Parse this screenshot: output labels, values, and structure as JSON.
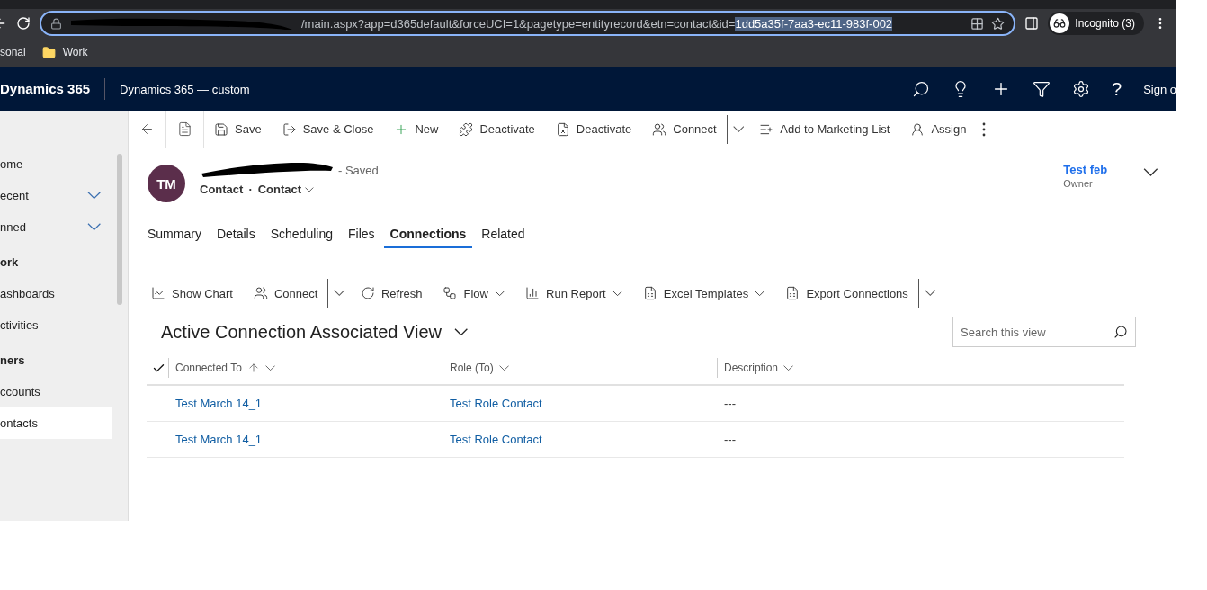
{
  "browser": {
    "url": "/main.aspx?app=d365default&forceUCI=1&pagetype=entityrecord&etn=contact&id=",
    "url_selected": "1dd5a35f-7aa3-ec11-983f-002",
    "profile": "Incognito (3)",
    "bookmarks": [
      "sonal",
      "Work"
    ]
  },
  "app": {
    "brand": "Dynamics 365",
    "title": "Dynamics 365 — custom",
    "help": "?",
    "user": "Sign o"
  },
  "sidebar": {
    "items": [
      {
        "label": "ome",
        "kind": "item",
        "selected": false
      },
      {
        "label": "ecent",
        "kind": "expander",
        "selected": false
      },
      {
        "label": "nned",
        "kind": "expander",
        "selected": false
      },
      {
        "label": "ork",
        "kind": "header",
        "selected": false
      },
      {
        "label": "ashboards",
        "kind": "item",
        "selected": false
      },
      {
        "label": "ctivities",
        "kind": "item",
        "selected": false
      },
      {
        "label": "ners",
        "kind": "header",
        "selected": false
      },
      {
        "label": "ccounts",
        "kind": "item",
        "selected": false
      },
      {
        "label": "ontacts",
        "kind": "item",
        "selected": true
      }
    ]
  },
  "commands": [
    {
      "label": "Save",
      "dropdown": false,
      "split": false
    },
    {
      "label": "Save & Close",
      "dropdown": false,
      "split": false
    },
    {
      "label": "New",
      "dropdown": false,
      "split": false
    },
    {
      "label": "Deactivate",
      "dropdown": false,
      "split": false
    },
    {
      "label": "Deactivate",
      "dropdown": false,
      "split": false
    },
    {
      "label": "Connect",
      "dropdown": false,
      "split": true
    },
    {
      "label": "Add to Marketing List",
      "dropdown": false,
      "split": false
    },
    {
      "label": "Assign",
      "dropdown": false,
      "split": false
    }
  ],
  "record": {
    "initials": "TM",
    "status": "- Saved",
    "entity": "Contact",
    "separator": "·",
    "form": "Contact",
    "owner": "Test feb",
    "owner_label": "Owner"
  },
  "tabs": [
    {
      "label": "Summary",
      "selected": false
    },
    {
      "label": "Details",
      "selected": false
    },
    {
      "label": "Scheduling",
      "selected": false
    },
    {
      "label": "Files",
      "selected": false
    },
    {
      "label": "Connections",
      "selected": true
    },
    {
      "label": "Related",
      "selected": false
    }
  ],
  "subgrid": {
    "commands": [
      {
        "label": "Show Chart",
        "dropdown": false,
        "split": false
      },
      {
        "label": "Connect",
        "dropdown": false,
        "split": true
      },
      {
        "label": "Refresh",
        "dropdown": false,
        "split": false
      },
      {
        "label": "Flow",
        "dropdown": true,
        "split": false
      },
      {
        "label": "Run Report",
        "dropdown": true,
        "split": false
      },
      {
        "label": "Excel Templates",
        "dropdown": true,
        "split": false
      },
      {
        "label": "Export Connections",
        "dropdown": false,
        "split": true
      }
    ],
    "view": "Active Connection Associated View",
    "search": {
      "placeholder": "Search this view"
    },
    "columns": [
      {
        "label": "Connected To",
        "sorted": true
      },
      {
        "label": "Role (To)",
        "sorted": false
      },
      {
        "label": "Description",
        "sorted": false
      }
    ],
    "rows": [
      [
        "Test March 14_1",
        "Test Role Contact",
        "---"
      ],
      [
        "Test March 14_1",
        "Test Role Contact",
        "---"
      ]
    ]
  }
}
